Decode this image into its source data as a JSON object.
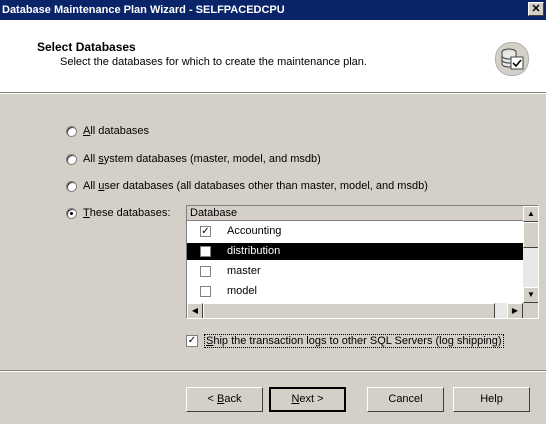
{
  "window": {
    "title": "Database Maintenance Plan Wizard - SELFPACEDCPU",
    "close_glyph": "✕"
  },
  "header": {
    "title": "Select Databases",
    "subtitle": "Select the databases for which to create the maintenance plan.",
    "icon": "database-check-icon"
  },
  "options": {
    "all": {
      "prefix": "",
      "mnemonic": "A",
      "suffix": "ll databases"
    },
    "system": {
      "prefix": "All ",
      "mnemonic": "s",
      "suffix": "ystem databases (master, model, and msdb)"
    },
    "user": {
      "prefix": "All ",
      "mnemonic": "u",
      "suffix": "ser databases (all databases other than master, model, and msdb)"
    },
    "these": {
      "prefix": "",
      "mnemonic": "T",
      "suffix": "hese databases:"
    },
    "selected": "these"
  },
  "db_list": {
    "column": "Database",
    "rows": [
      {
        "name": "Accounting",
        "checked": true,
        "selected": false
      },
      {
        "name": "distribution",
        "checked": false,
        "selected": true
      },
      {
        "name": "master",
        "checked": false,
        "selected": false
      },
      {
        "name": "model",
        "checked": false,
        "selected": false
      }
    ]
  },
  "ship_logs": {
    "checked": true,
    "prefix": "",
    "mnemonic": "S",
    "suffix": "hip the transaction logs to other SQL Servers (log shipping)"
  },
  "buttons": {
    "back": {
      "prefix": "< ",
      "mnemonic": "B",
      "suffix": "ack"
    },
    "next": {
      "prefix": "",
      "mnemonic": "N",
      "suffix": "ext >"
    },
    "cancel": "Cancel",
    "help": "Help"
  }
}
